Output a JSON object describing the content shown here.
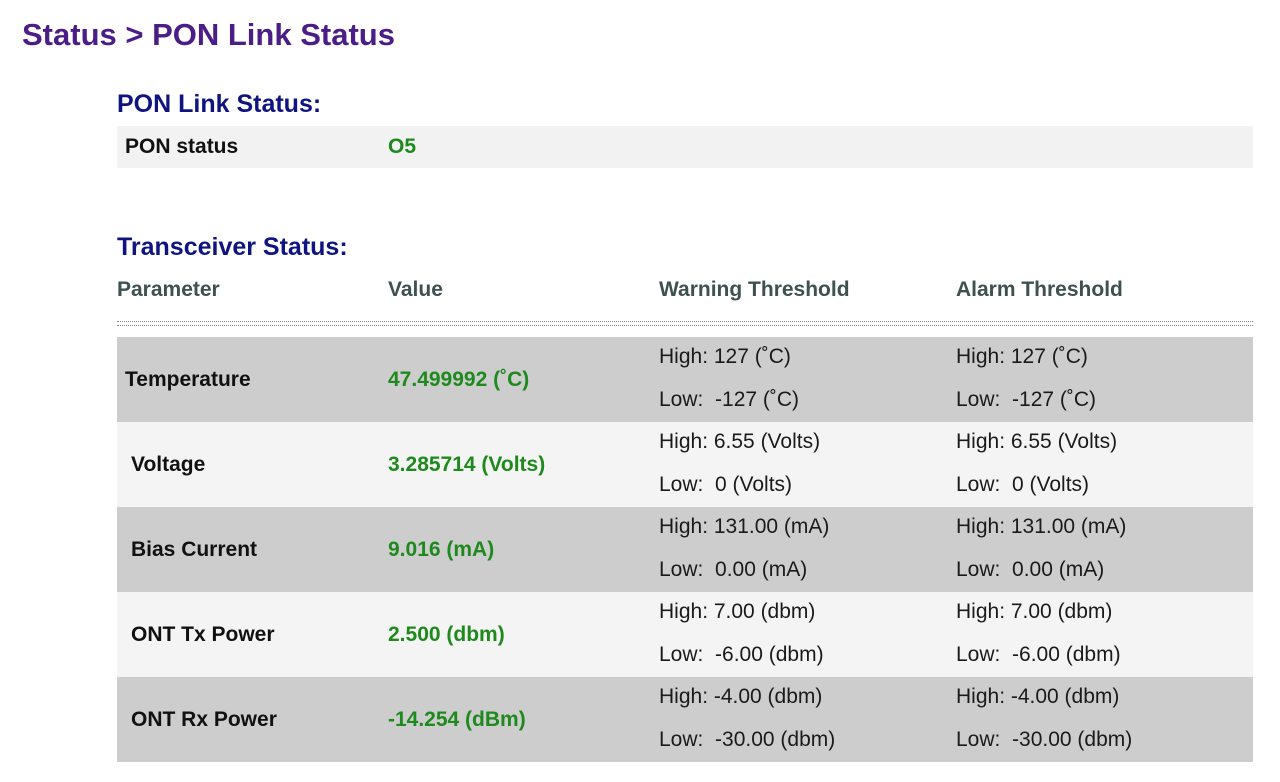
{
  "breadcrumb": "Status > PON Link Status",
  "pon_section": {
    "title": "PON Link Status:",
    "label": "PON status",
    "value": "O5"
  },
  "transceiver": {
    "title": "Transceiver Status:",
    "headers": {
      "parameter": "Parameter",
      "value": "Value",
      "warning": "Warning Threshold",
      "alarm": "Alarm Threshold"
    },
    "rows": [
      {
        "name": "Temperature",
        "value": "47.499992 (˚C)",
        "warn_high": "High: 127 (˚C)",
        "warn_low": "Low:  -127 (˚C)",
        "alarm_high": "High: 127 (˚C)",
        "alarm_low": "Low:  -127 (˚C)"
      },
      {
        "name": "Voltage",
        "value": "3.285714 (Volts)",
        "warn_high": "High: 6.55 (Volts)",
        "warn_low": "Low:  0 (Volts)",
        "alarm_high": "High: 6.55 (Volts)",
        "alarm_low": "Low:  0 (Volts)"
      },
      {
        "name": "Bias Current",
        "value": "9.016 (mA)",
        "warn_high": "High: 131.00 (mA)",
        "warn_low": "Low:  0.00 (mA)",
        "alarm_high": "High: 131.00 (mA)",
        "alarm_low": "Low:  0.00 (mA)"
      },
      {
        "name": "ONT Tx Power",
        "value": "2.500 (dbm)",
        "warn_high": "High: 7.00 (dbm)",
        "warn_low": "Low:  -6.00 (dbm)",
        "alarm_high": "High: 7.00 (dbm)",
        "alarm_low": "Low:  -6.00 (dbm)"
      },
      {
        "name": "ONT Rx Power",
        "value": "-14.254 (dBm)",
        "warn_high": "High: -4.00 (dbm)",
        "warn_low": "Low:  -30.00 (dbm)",
        "alarm_high": "High: -4.00 (dbm)",
        "alarm_low": "Low:  -30.00 (dbm)"
      }
    ]
  },
  "colors": {
    "title": "#4a1d87",
    "section_title": "#101480",
    "value_green": "#1e8a1e",
    "row_dark": "#cdcdcd",
    "row_light": "#f4f4f4"
  }
}
